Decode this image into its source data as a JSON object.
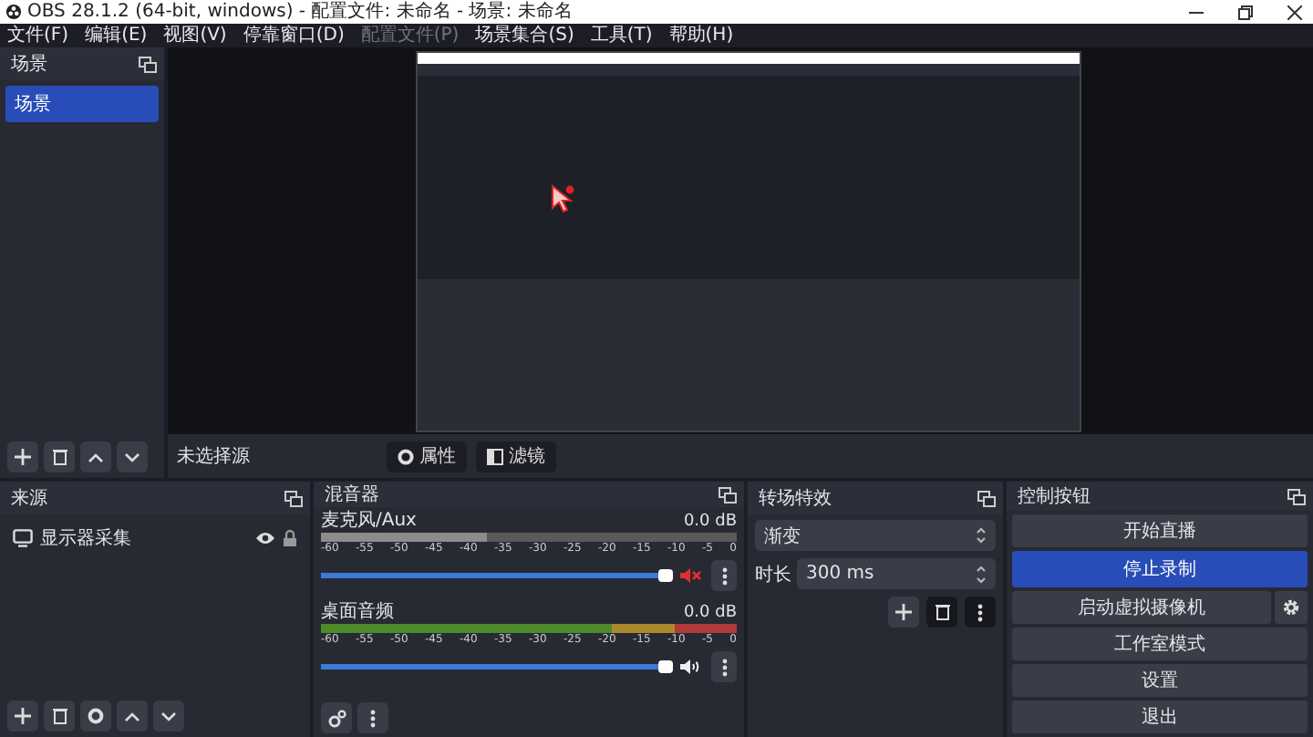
{
  "window": {
    "title": "OBS 28.1.2 (64-bit, windows) - 配置文件: 未命名 - 场景: 未命名"
  },
  "menu": [
    {
      "label": "文件(F)",
      "disabled": false
    },
    {
      "label": "编辑(E)",
      "disabled": false
    },
    {
      "label": "视图(V)",
      "disabled": false
    },
    {
      "label": "停靠窗口(D)",
      "disabled": false
    },
    {
      "label": "配置文件(P)",
      "disabled": true
    },
    {
      "label": "场景集合(S)",
      "disabled": false
    },
    {
      "label": "工具(T)",
      "disabled": false
    },
    {
      "label": "帮助(H)",
      "disabled": false
    }
  ],
  "scenes": {
    "title": "场景",
    "items": [
      {
        "label": "场景",
        "selected": true
      }
    ]
  },
  "context_bar": {
    "label": "未选择源",
    "buttons": [
      {
        "kind": "properties",
        "label": "属性"
      },
      {
        "kind": "filters",
        "label": "滤镜"
      }
    ]
  },
  "sources": {
    "title": "来源",
    "items": [
      {
        "label": "显示器采集",
        "visible": true,
        "locked": true
      }
    ]
  },
  "mixer": {
    "title": "混音器",
    "channels": [
      {
        "name": "麦克风/Aux",
        "reading": "0.0 dB",
        "muted": true,
        "level": 1,
        "ticks": [
          "-60",
          "-55",
          "-50",
          "-45",
          "-40",
          "-35",
          "-30",
          "-25",
          "-20",
          "-15",
          "-10",
          "-5",
          "0"
        ]
      },
      {
        "name": "桌面音频",
        "reading": "0.0 dB",
        "muted": false,
        "level": 1,
        "ticks": [
          "-60",
          "-55",
          "-50",
          "-45",
          "-40",
          "-35",
          "-30",
          "-25",
          "-20",
          "-15",
          "-10",
          "-5",
          "0"
        ]
      }
    ]
  },
  "transitions": {
    "title": "转场特效",
    "type": "渐变",
    "duration_label": "时长",
    "duration": "300 ms"
  },
  "controls": {
    "title": "控制按钮",
    "buttons": [
      {
        "label": "开始直播",
        "active": false,
        "kind": "plain"
      },
      {
        "label": "停止录制",
        "active": true,
        "kind": "plain"
      },
      {
        "label": "启动虚拟摄像机",
        "active": false,
        "kind": "split"
      },
      {
        "label": "工作室模式",
        "active": false,
        "kind": "plain"
      },
      {
        "label": "设置",
        "active": false,
        "kind": "plain"
      },
      {
        "label": "退出",
        "active": false,
        "kind": "plain"
      }
    ]
  }
}
